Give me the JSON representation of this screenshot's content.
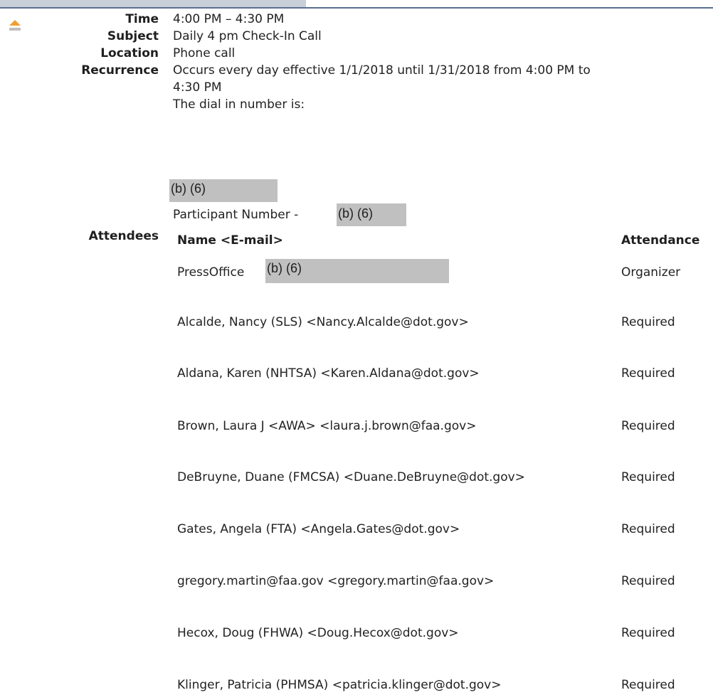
{
  "header": {
    "time_label": "Time",
    "time_value": "4:00 PM – 4:30 PM",
    "subject_label": "Subject",
    "subject_value": "Daily 4 pm Check-In Call",
    "location_label": "Location",
    "location_value": "Phone call",
    "recurrence_label": "Recurrence",
    "recurrence_line1": "Occurs every day effective 1/1/2018 until 1/31/2018 from 4:00 PM to",
    "recurrence_line2": "4:30 PM",
    "dial_in_text": "The dial in number is:",
    "redaction_code": "(b) (6)",
    "participant_label": "Participant Number -"
  },
  "attendees": {
    "label": "Attendees",
    "col_name": "Name <E-mail>",
    "col_attendance": "Attendance",
    "rows": [
      {
        "name": "PressOffice",
        "attendance": "Organizer"
      },
      {
        "name": "Alcalde, Nancy (SLS) <Nancy.Alcalde@dot.gov>",
        "attendance": "Required"
      },
      {
        "name": "Aldana, Karen (NHTSA) <Karen.Aldana@dot.gov>",
        "attendance": "Required"
      },
      {
        "name": "Brown, Laura J <AWA> <laura.j.brown@faa.gov>",
        "attendance": "Required"
      },
      {
        "name": "DeBruyne, Duane (FMCSA) <Duane.DeBruyne@dot.gov>",
        "attendance": "Required"
      },
      {
        "name": "Gates, Angela (FTA) <Angela.Gates@dot.gov>",
        "attendance": "Required"
      },
      {
        "name": "gregory.martin@faa.gov <gregory.martin@faa.gov>",
        "attendance": "Required"
      },
      {
        "name": "Hecox, Doug (FHWA) <Doug.Hecox@dot.gov>",
        "attendance": "Required"
      },
      {
        "name": "Klinger, Patricia (PHMSA) <patricia.klinger@dot.gov>",
        "attendance": "Required"
      }
    ]
  }
}
